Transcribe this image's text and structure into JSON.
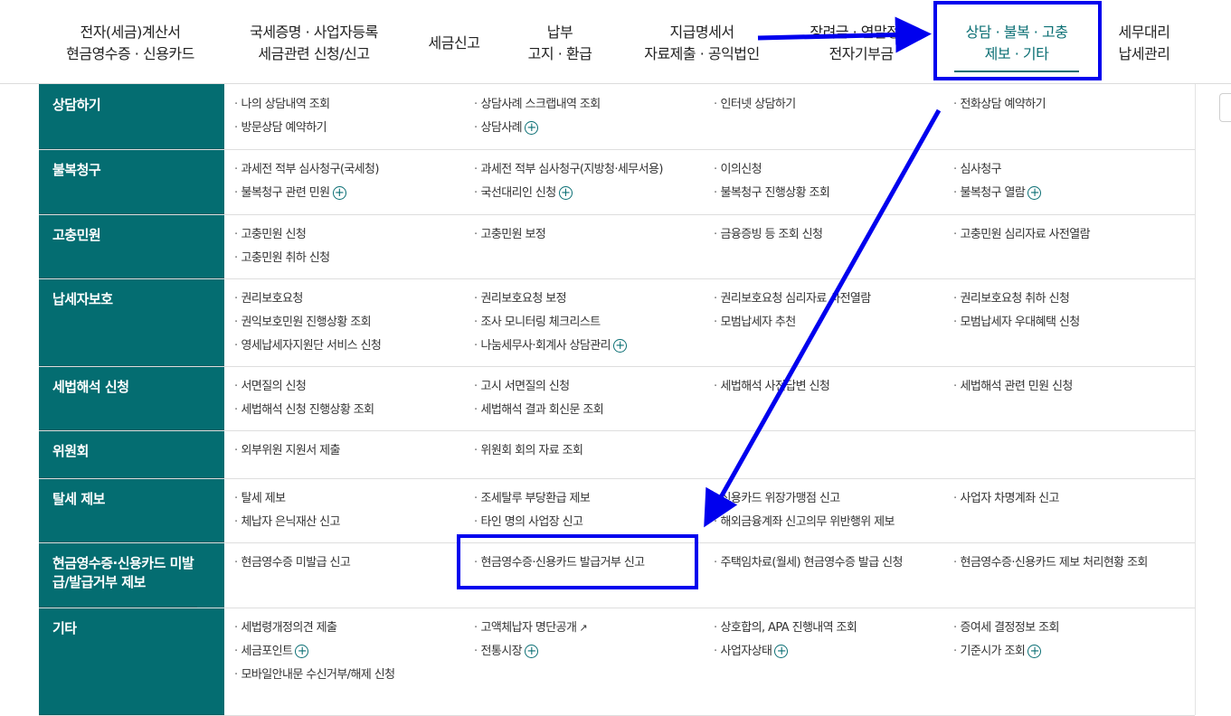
{
  "nav": [
    {
      "line1": "전자(세금)계산서",
      "line2": "현금영수증 · 신용카드"
    },
    {
      "line1": "국세증명 · 사업자등록",
      "line2": "세금관련 신청/신고"
    },
    {
      "line1": "세금신고",
      "line2": ""
    },
    {
      "line1": "납부",
      "line2": "고지 · 환급"
    },
    {
      "line1": "지급명세서",
      "line2": "자료제출 · 공익법인"
    },
    {
      "line1": "장려금 · 연말정산",
      "line2": "전자기부금"
    },
    {
      "line1": "상담 · 불복 · 고충",
      "line2": "제보 · 기타"
    },
    {
      "line1": "세무대리",
      "line2": "납세관리"
    }
  ],
  "menu": [
    {
      "head": "상담하기",
      "items": [
        {
          "text": "나의 상담내역 조회"
        },
        {
          "text": "상담사례 스크랩내역 조회"
        },
        {
          "text": "인터넷 상담하기"
        },
        {
          "text": "전화상담 예약하기"
        },
        {
          "text": "방문상담 예약하기"
        },
        {
          "text": "상담사례",
          "icon": "plus-icon"
        }
      ]
    },
    {
      "head": "불복청구",
      "items": [
        {
          "text": "과세전 적부 심사청구(국세청)"
        },
        {
          "text": "과세전 적부 심사청구(지방청·세무서용)"
        },
        {
          "text": "이의신청"
        },
        {
          "text": "심사청구"
        },
        {
          "text": "불복청구 관련 민원",
          "icon": "plus-icon"
        },
        {
          "text": "국선대리인 신청",
          "icon": "plus-icon"
        },
        {
          "text": "불복청구 진행상황 조회"
        },
        {
          "text": "불복청구 열람",
          "icon": "plus-icon"
        }
      ]
    },
    {
      "head": "고충민원",
      "items": [
        {
          "text": "고충민원 신청"
        },
        {
          "text": "고충민원 보정"
        },
        {
          "text": "금융증빙 등 조회 신청"
        },
        {
          "text": "고충민원 심리자료 사전열람"
        },
        {
          "text": "고충민원 취하 신청"
        }
      ]
    },
    {
      "head": "납세자보호",
      "items": [
        {
          "text": "권리보호요청"
        },
        {
          "text": "권리보호요청 보정"
        },
        {
          "text": "권리보호요청 심리자료 사전열람"
        },
        {
          "text": "권리보호요청 취하 신청"
        },
        {
          "text": "권익보호민원 진행상황 조회"
        },
        {
          "text": "조사 모니터링 체크리스트"
        },
        {
          "text": "모범납세자 추천"
        },
        {
          "text": "모범납세자 우대혜택 신청"
        },
        {
          "text": "영세납세자지원단 서비스 신청"
        },
        {
          "text": "나눔세무사·회계사 상담관리",
          "icon": "plus-icon"
        }
      ]
    },
    {
      "head": "세법해석 신청",
      "items": [
        {
          "text": "서면질의 신청"
        },
        {
          "text": "고시 서면질의 신청"
        },
        {
          "text": "세법해석 사전답변 신청"
        },
        {
          "text": "세법해석 관련 민원 신청"
        },
        {
          "text": "세법해석 신청 진행상황 조회"
        },
        {
          "text": "세법해석 결과 회신문 조회"
        }
      ]
    },
    {
      "head": "위원회",
      "items": [
        {
          "text": "외부위원 지원서 제출"
        },
        {
          "text": "위원회 회의 자료 조회"
        }
      ]
    },
    {
      "head": "탈세 제보",
      "items": [
        {
          "text": "탈세 제보"
        },
        {
          "text": "조세탈루 부당환급 제보"
        },
        {
          "text": "신용카드 위장가맹점 신고"
        },
        {
          "text": "사업자 차명계좌 신고"
        },
        {
          "text": "체납자 은닉재산 신고"
        },
        {
          "text": "타인 명의 사업장 신고"
        },
        {
          "text": "해외금융계좌 신고의무 위반행위 제보"
        }
      ]
    },
    {
      "head": "현금영수증·신용카드 미발급/발급거부 제보",
      "items": [
        {
          "text": "현금영수증 미발급 신고"
        },
        {
          "text": "현금영수증·신용카드 발급거부 신고"
        },
        {
          "text": "주택임차료(월세) 현금영수증 발급 신청"
        },
        {
          "text": "현금영수증·신용카드 제보 처리현황 조회"
        }
      ]
    },
    {
      "head": "기타",
      "items": [
        {
          "text": "세법령개정의견 제출"
        },
        {
          "text": "고액체납자 명단공개",
          "icon": "external-link-icon"
        },
        {
          "text": "상호합의, APA 진행내역 조회"
        },
        {
          "text": "증여세 결정정보 조회"
        },
        {
          "text": "세금포인트",
          "icon": "plus-icon"
        },
        {
          "text": "전통시장",
          "icon": "plus-icon"
        },
        {
          "text": "사업자상태",
          "icon": "plus-icon"
        },
        {
          "text": "기준시가 조회",
          "icon": "plus-icon"
        },
        {
          "text": "모바일안내문 수신거부/해제 신청"
        }
      ]
    }
  ],
  "colors": {
    "accent": "#046d71",
    "annotation": "#0000ee"
  }
}
